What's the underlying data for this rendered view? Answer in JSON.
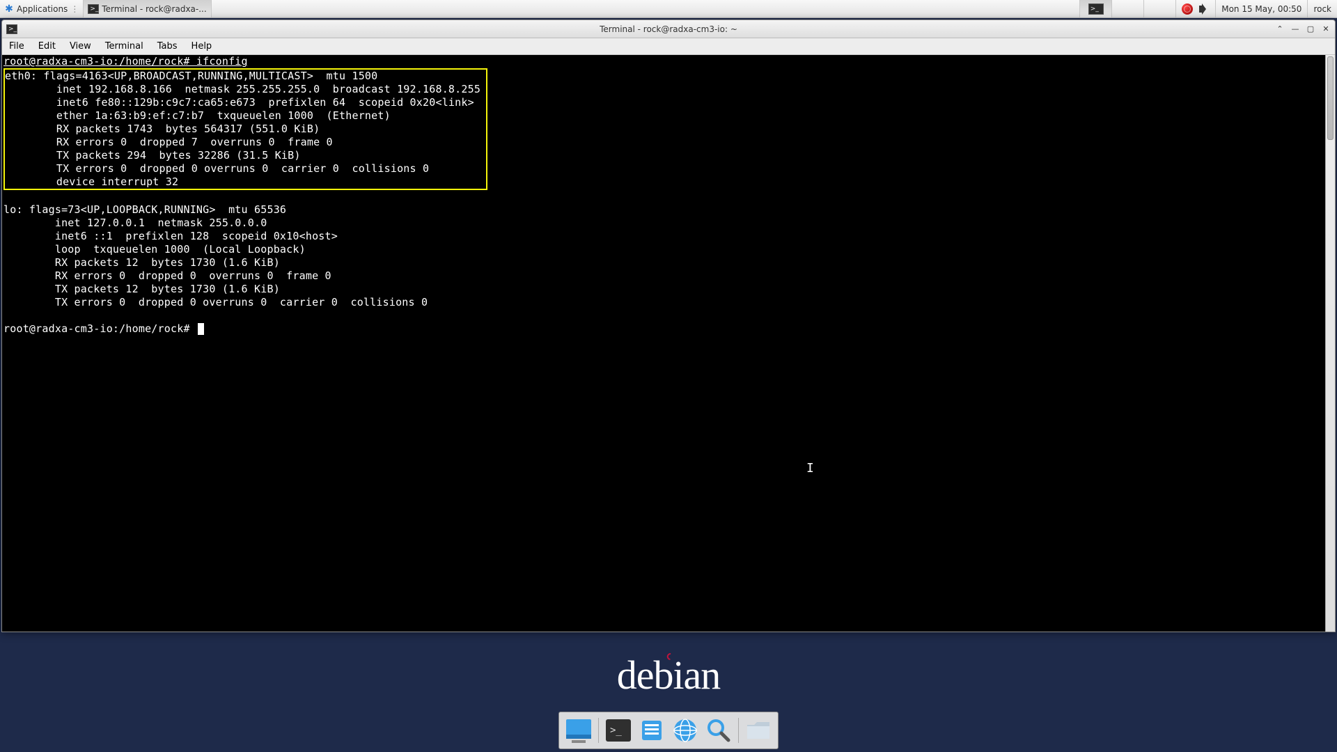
{
  "panel": {
    "applications_label": "Applications",
    "task_label": "Terminal - rock@radxa-...",
    "clock": "Mon 15 May, 00:50",
    "user": "rock"
  },
  "window": {
    "title": "Terminal - rock@radxa-cm3-io: ~",
    "menus": [
      "File",
      "Edit",
      "View",
      "Terminal",
      "Tabs",
      "Help"
    ]
  },
  "terminal": {
    "prompt1": "root@radxa-cm3-io:/home/rock# ifconfig",
    "eth0_block": "eth0: flags=4163<UP,BROADCAST,RUNNING,MULTICAST>  mtu 1500\n        inet 192.168.8.166  netmask 255.255.255.0  broadcast 192.168.8.255\n        inet6 fe80::129b:c9c7:ca65:e673  prefixlen 64  scopeid 0x20<link>\n        ether 1a:63:b9:ef:c7:b7  txqueuelen 1000  (Ethernet)\n        RX packets 1743  bytes 564317 (551.0 KiB)\n        RX errors 0  dropped 7  overruns 0  frame 0\n        TX packets 294  bytes 32286 (31.5 KiB)\n        TX errors 0  dropped 0 overruns 0  carrier 0  collisions 0\n        device interrupt 32  ",
    "lo_block": "lo: flags=73<UP,LOOPBACK,RUNNING>  mtu 65536\n        inet 127.0.0.1  netmask 255.0.0.0\n        inet6 ::1  prefixlen 128  scopeid 0x10<host>\n        loop  txqueuelen 1000  (Local Loopback)\n        RX packets 12  bytes 1730 (1.6 KiB)\n        RX errors 0  dropped 0  overruns 0  frame 0\n        TX packets 12  bytes 1730 (1.6 KiB)\n        TX errors 0  dropped 0 overruns 0  carrier 0  collisions 0",
    "prompt2": "root@radxa-cm3-io:/home/rock# "
  },
  "brand": {
    "name": "debian"
  },
  "dock": {
    "items": [
      {
        "name": "show-desktop"
      },
      {
        "name": "terminal"
      },
      {
        "name": "file-manager"
      },
      {
        "name": "web-browser"
      },
      {
        "name": "search"
      },
      {
        "name": "files-folder"
      }
    ]
  }
}
